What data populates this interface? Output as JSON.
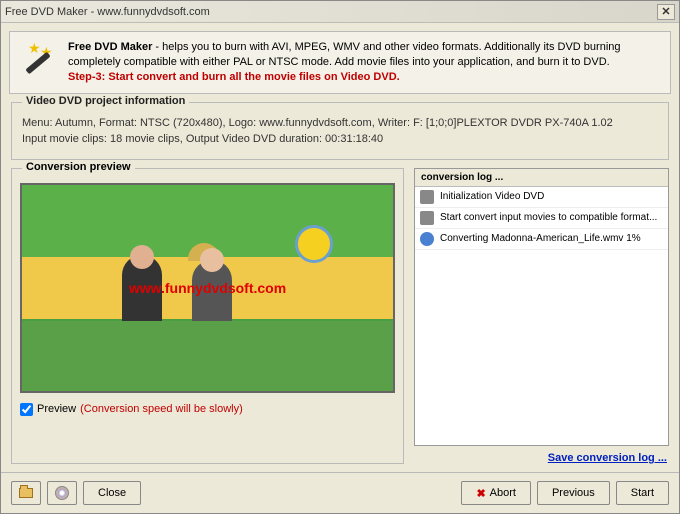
{
  "titlebar": "Free DVD Maker - www.funnydvdsoft.com",
  "header": {
    "line1a": "Free DVD Maker",
    "line1b": " - helps you to burn with AVI, MPEG, WMV and other video formats. Additionally its DVD burning completely compatible with either PAL or NTSC mode. Add movie files into your application, and burn it to DVD.",
    "step": "Step-3: Start convert and burn all the movie files on Video DVD."
  },
  "project": {
    "legend": "Video DVD project information",
    "line1": "Menu: Autumn, Format: NTSC (720x480), Logo: www.funnydvdsoft.com, Writer: F: [1;0;0]PLEXTOR  DVDR   PX-740A   1.02",
    "line2": "Input movie clips: 18 movie clips, Output Video DVD duration: 00:31:18:40"
  },
  "preview": {
    "legend": "Conversion preview",
    "watermark": "www.funnydvdsoft.com",
    "checkbox_label": "Preview",
    "checkbox_note": "(Conversion speed will be slowly)"
  },
  "log": {
    "header": "conversion log ...",
    "items": [
      "Initialization Video DVD",
      "Start convert input movies to compatible format...",
      "Converting Madonna-American_Life.wmv  1%"
    ],
    "save_link": "Save conversion log ..."
  },
  "buttons": {
    "close": "Close",
    "abort": "Abort",
    "previous": "Previous",
    "start": "Start"
  }
}
